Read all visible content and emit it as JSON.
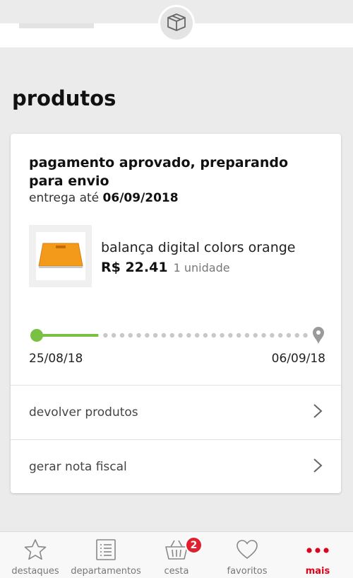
{
  "section": {
    "title": "produtos"
  },
  "order": {
    "status": "pagamento aprovado, preparando para envio",
    "delivery_prefix": "entrega até",
    "delivery_date": "06/09/2018",
    "product": {
      "name": "balança digital colors orange",
      "price": "R$ 22.41",
      "quantity": "1 unidade",
      "image_color": "#f49a1a"
    },
    "progress": {
      "start_date": "25/08/18",
      "end_date": "06/09/18",
      "fraction_complete": 0.22,
      "active_color": "#7ac143",
      "inactive_color": "#c8c8c8"
    },
    "actions": [
      {
        "label": "devolver produtos"
      },
      {
        "label": "gerar nota fiscal"
      }
    ]
  },
  "tabbar": {
    "tabs": [
      {
        "label": "destaques",
        "icon": "star-icon"
      },
      {
        "label": "departamentos",
        "icon": "list-icon"
      },
      {
        "label": "cesta",
        "icon": "basket-icon",
        "badge": "2"
      },
      {
        "label": "favoritos",
        "icon": "heart-icon"
      },
      {
        "label": "mais",
        "icon": "more-dots-icon",
        "active": true
      }
    ],
    "active_color": "#d9061c"
  }
}
